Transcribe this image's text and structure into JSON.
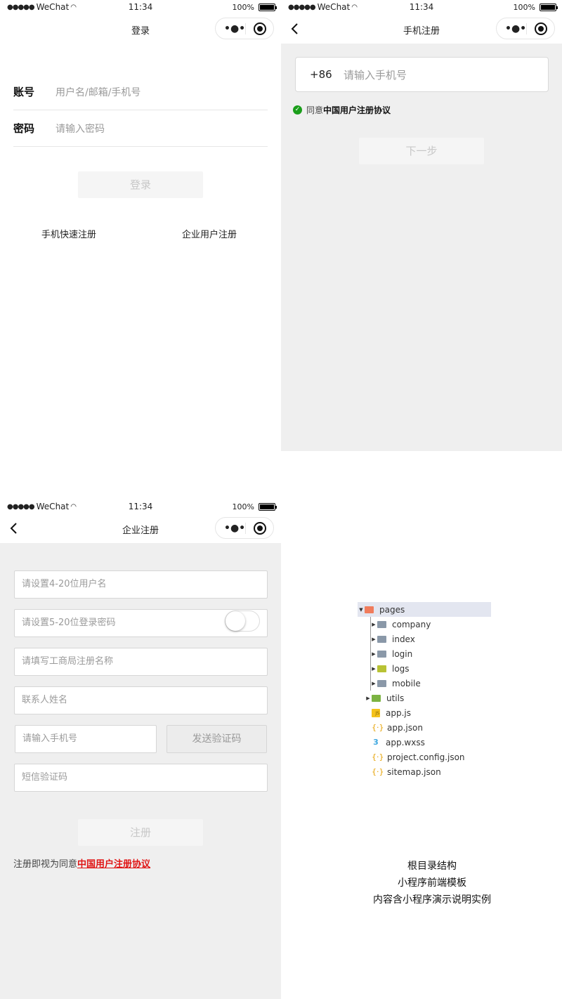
{
  "status_bar": {
    "signal": "●●●●●",
    "carrier": "WeChat",
    "time": "11:34",
    "battery": "100%"
  },
  "login": {
    "title": "登录",
    "account_label": "账号",
    "account_placeholder": "用户名/邮箱/手机号",
    "password_label": "密码",
    "password_placeholder": "请输入密码",
    "login_button": "登录",
    "link_phone_register": "手机快速注册",
    "link_enterprise_register": "企业用户注册"
  },
  "phone_register": {
    "title": "手机注册",
    "country_code": "+86",
    "phone_placeholder": "请输入手机号",
    "agree_prefix": "同意",
    "agreement_link": "中国用户注册协议",
    "next_button": "下一步"
  },
  "enterprise_register": {
    "title": "企业注册",
    "username_placeholder": "请设置4-20位用户名",
    "password_placeholder": "请设置5-20位登录密码",
    "company_placeholder": "请填写工商局注册名称",
    "contact_placeholder": "联系人姓名",
    "phone_placeholder": "请输入手机号",
    "send_code_button": "发送验证码",
    "sms_code_placeholder": "短信验证码",
    "register_button": "注册",
    "terms_prefix": "注册即视为同意",
    "terms_link": "中国用户注册协议"
  },
  "file_tree": {
    "items": [
      {
        "label": "pages",
        "expanded": true,
        "icon": "folder-open-icon",
        "color": "#f07c5c"
      },
      {
        "label": "company",
        "icon": "folder-icon",
        "color": "#8a98a8"
      },
      {
        "label": "index",
        "icon": "folder-icon",
        "color": "#8a98a8"
      },
      {
        "label": "login",
        "icon": "folder-icon",
        "color": "#8a98a8"
      },
      {
        "label": "logs",
        "icon": "folder-icon",
        "color": "#b8c234"
      },
      {
        "label": "mobile",
        "icon": "folder-icon",
        "color": "#8a98a8"
      },
      {
        "label": "utils",
        "icon": "folder-icon",
        "color": "#7cb342"
      },
      {
        "label": "app.js",
        "icon": "js-file-icon",
        "color": "#f4c21b"
      },
      {
        "label": "app.json",
        "icon": "json-file-icon",
        "color": "#e6a100"
      },
      {
        "label": "app.wxss",
        "icon": "css-file-icon",
        "color": "#3ea7e0"
      },
      {
        "label": "project.config.json",
        "icon": "json-file-icon",
        "color": "#e6a100"
      },
      {
        "label": "sitemap.json",
        "icon": "json-file-icon",
        "color": "#e6a100"
      }
    ]
  },
  "caption": {
    "line1": "根目录结构",
    "line2": "小程序前端模板",
    "line3": "内容含小程序演示说明实例"
  },
  "colors": {
    "panel_gray": "#efefef",
    "disabled_text": "#c7c7c7",
    "check_green": "#1a9e1a",
    "link_red": "#e01515"
  }
}
